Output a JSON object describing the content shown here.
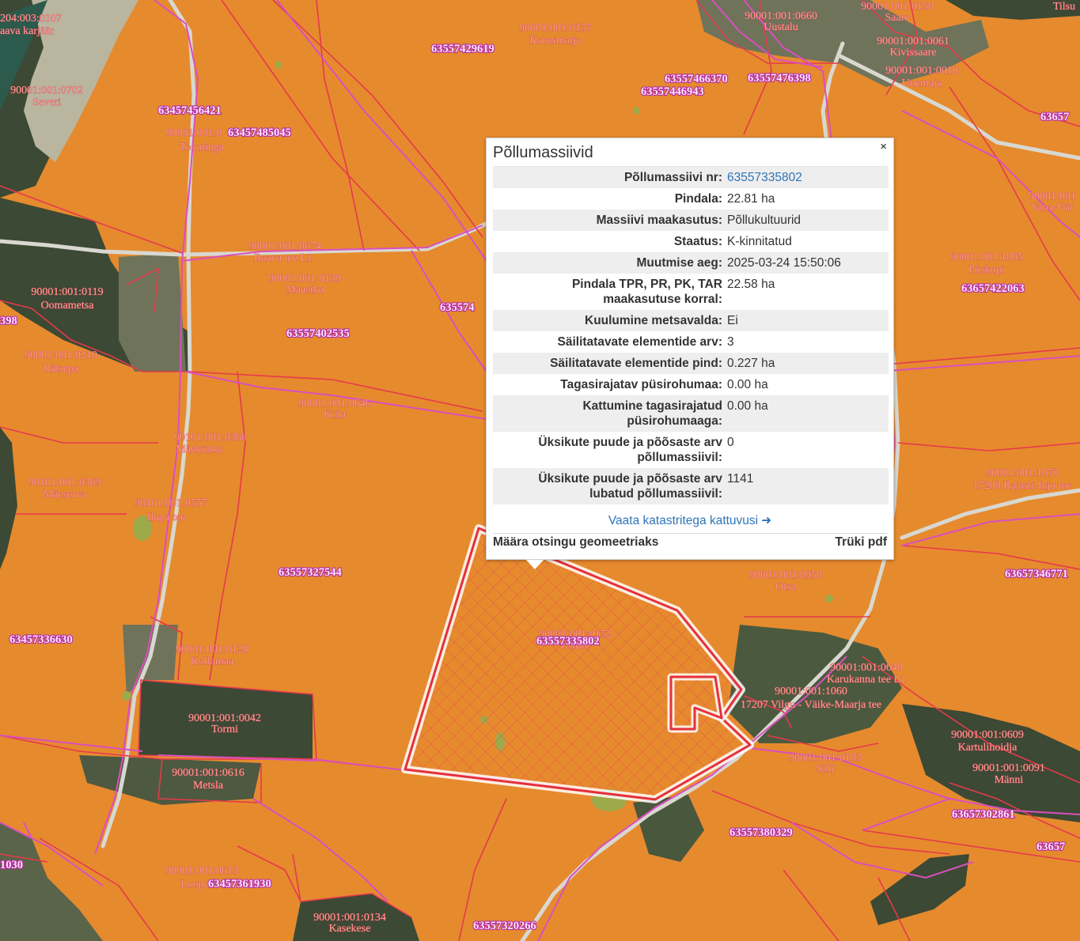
{
  "map": {
    "colors": {
      "field": "#e68a2e",
      "forest": "#3a4a33",
      "cadastre_line": "#e53a4c",
      "field_line": "#d94fc0",
      "road": "#d8d8d0",
      "selection": "#e53a4c"
    },
    "cadastre_labels": [
      {
        "id": "c1",
        "text": "204:003:0107",
        "sub": "aava karjäär"
      },
      {
        "id": "c2",
        "text": "90001:001:0137",
        "sub": "Karusmarja"
      },
      {
        "id": "c3",
        "text": "90001:001:0660",
        "sub": "Uustalu"
      },
      {
        "id": "c4",
        "text": "90001:001:0150",
        "sub": "Saare"
      },
      {
        "id": "c5",
        "text": "90001:001:0061",
        "sub": "Kivissaare"
      },
      {
        "id": "c6",
        "text": "90001:001:0010",
        "sub": "Uuemaja"
      },
      {
        "id": "c7",
        "text": "90001:001:0702",
        "sub": "Severi"
      },
      {
        "id": "c8",
        "text": "90001:001:0",
        "sub": "Toominga"
      },
      {
        "id": "c9",
        "text": "90001:001:0674",
        "sub": "Raava tee L1"
      },
      {
        "id": "c10",
        "text": "90001:001:0139",
        "sub": "Maasika"
      },
      {
        "id": "c11",
        "text": "90001:001:0119",
        "sub": "Oomametsa"
      },
      {
        "id": "c12",
        "text": "90001:001:0210",
        "sub": "Rätsepa"
      },
      {
        "id": "c13",
        "text": "90001:001:0646",
        "sub": "Kiila"
      },
      {
        "id": "c14",
        "text": "90101:001:0368",
        "sub": "Mäekünka"
      },
      {
        "id": "c15",
        "text": "90101:001:0369",
        "sub": "Mäeserva"
      },
      {
        "id": "c16",
        "text": "90101:001:0557",
        "sub": "Ilupa tee"
      },
      {
        "id": "c17",
        "text": "90001:001:1005",
        "sub": "Piiskopi"
      },
      {
        "id": "c18",
        "text": "90001:001",
        "sub": "Vana-Vär"
      },
      {
        "id": "c19",
        "text": "90001:001:1070",
        "sub": "17200 Rajasti-Inju tee"
      },
      {
        "id": "c20",
        "text": "90001:001:0950",
        "sub": "Otsa"
      },
      {
        "id": "c21",
        "text": "90001:001:0128",
        "sub": "Kollamaa"
      },
      {
        "id": "c22",
        "text": "90001:001:0042",
        "sub": "Tormi"
      },
      {
        "id": "c23",
        "text": "90001:001:0616",
        "sub": "Metsla"
      },
      {
        "id": "c24",
        "text": "90001:001:0640",
        "sub": "Karukanna tee L1"
      },
      {
        "id": "c25",
        "text": "90001:001:1060",
        "sub": "17207 Vilgu - Väike-Maarja tee"
      },
      {
        "id": "c26",
        "text": "90001:001:0609",
        "sub": "Kartulihoidja"
      },
      {
        "id": "c27",
        "text": "90001:001:0103",
        "sub": "Silli"
      },
      {
        "id": "c28",
        "text": "90001:001:0091",
        "sub": "Männi"
      },
      {
        "id": "c29",
        "text": "90001:001:0613",
        "sub": "Loopi"
      },
      {
        "id": "c30",
        "text": "90001:001:0134",
        "sub": "Kasekese"
      },
      {
        "id": "c31",
        "text": "90001:001:0152",
        "sub": "Põldre"
      },
      {
        "id": "c32",
        "text": "90001:001:0557",
        "sub": "Tilsu"
      }
    ],
    "field_labels": [
      {
        "id": "f1",
        "text": "63557429619"
      },
      {
        "id": "f2",
        "text": "63557466370"
      },
      {
        "id": "f3",
        "text": "63557476398"
      },
      {
        "id": "f4",
        "text": "63557446943"
      },
      {
        "id": "f5",
        "text": "63457456421"
      },
      {
        "id": "f6",
        "text": "63457485045"
      },
      {
        "id": "f7",
        "text": "63657422063"
      },
      {
        "id": "f8",
        "text": "63557402535"
      },
      {
        "id": "f9",
        "text": "63557327544"
      },
      {
        "id": "f10",
        "text": "63457336630"
      },
      {
        "id": "f11",
        "text": "63557335802"
      },
      {
        "id": "f12",
        "text": "63657346771"
      },
      {
        "id": "f13",
        "text": "63557380329"
      },
      {
        "id": "f14",
        "text": "63657302861"
      },
      {
        "id": "f15",
        "text": "63457361930"
      },
      {
        "id": "f16",
        "text": "63557320266"
      },
      {
        "id": "f17",
        "text": "63657"
      },
      {
        "id": "f18",
        "text": "63657"
      },
      {
        "id": "f19",
        "text": "635574"
      },
      {
        "id": "f20",
        "text": "1030"
      },
      {
        "id": "f21",
        "text": "398"
      }
    ]
  },
  "popup": {
    "title": "Põllumassiivid",
    "close_glyph": "×",
    "rows": [
      {
        "key": "Põllumassiivi nr:",
        "value": "63557335802",
        "link": true
      },
      {
        "key": "Pindala:",
        "value": "22.81 ha"
      },
      {
        "key": "Massiivi maakasutus:",
        "value": "Põllukultuurid"
      },
      {
        "key": "Staatus:",
        "value": "K-kinnitatud"
      },
      {
        "key": "Muutmise aeg:",
        "value": "2025-03-24 15:50:06"
      },
      {
        "key": "Pindala TPR, PR, PK, TAR maakasutuse korral:",
        "value": "22.58 ha"
      },
      {
        "key": "Kuulumine metsavalda:",
        "value": "Ei"
      },
      {
        "key": "Säilitatavate elementide arv:",
        "value": "3"
      },
      {
        "key": "Säilitatavate elementide pind:",
        "value": "0.227 ha"
      },
      {
        "key": "Tagasirajatav püsirohumaa:",
        "value": "0.00 ha"
      },
      {
        "key": "Kattumine tagasirajatud püsirohumaaga:",
        "value": "0.00 ha"
      },
      {
        "key": "Üksikute puude ja põõsaste arv põllumassiivil:",
        "value": "0"
      },
      {
        "key": "Üksikute puude ja põõsaste arv lubatud põllumassiivil:",
        "value": "1141"
      }
    ],
    "overlap_link": "Vaata katastritega kattuvusi",
    "footer_left": "Määra otsingu geomeetriaks",
    "footer_right": "Trüki pdf"
  }
}
